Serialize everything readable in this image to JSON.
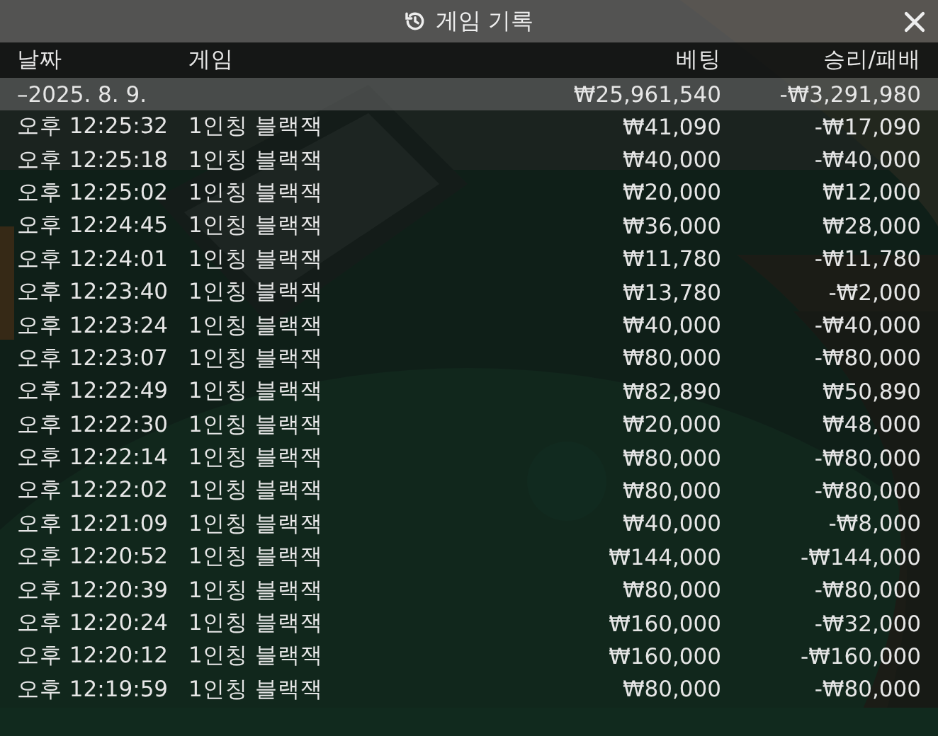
{
  "title": "게임 기록",
  "columns": [
    "날짜",
    "게임",
    "베팅",
    "승리/패배"
  ],
  "date_group": {
    "date": "–2025. 8. 9.",
    "bet": "₩25,961,540",
    "result": "-₩3,291,980"
  },
  "rows": [
    {
      "time": "오후 12:25:32",
      "game": "1인칭 블랙잭",
      "bet": "₩41,090",
      "result": "-₩17,090"
    },
    {
      "time": "오후 12:25:18",
      "game": "1인칭 블랙잭",
      "bet": "₩40,000",
      "result": "-₩40,000"
    },
    {
      "time": "오후 12:25:02",
      "game": "1인칭 블랙잭",
      "bet": "₩20,000",
      "result": "₩12,000"
    },
    {
      "time": "오후 12:24:45",
      "game": "1인칭 블랙잭",
      "bet": "₩36,000",
      "result": "₩28,000"
    },
    {
      "time": "오후 12:24:01",
      "game": "1인칭 블랙잭",
      "bet": "₩11,780",
      "result": "-₩11,780"
    },
    {
      "time": "오후 12:23:40",
      "game": "1인칭 블랙잭",
      "bet": "₩13,780",
      "result": "-₩2,000"
    },
    {
      "time": "오후 12:23:24",
      "game": "1인칭 블랙잭",
      "bet": "₩40,000",
      "result": "-₩40,000"
    },
    {
      "time": "오후 12:23:07",
      "game": "1인칭 블랙잭",
      "bet": "₩80,000",
      "result": "-₩80,000"
    },
    {
      "time": "오후 12:22:49",
      "game": "1인칭 블랙잭",
      "bet": "₩82,890",
      "result": "₩50,890"
    },
    {
      "time": "오후 12:22:30",
      "game": "1인칭 블랙잭",
      "bet": "₩20,000",
      "result": "₩48,000"
    },
    {
      "time": "오후 12:22:14",
      "game": "1인칭 블랙잭",
      "bet": "₩80,000",
      "result": "-₩80,000"
    },
    {
      "time": "오후 12:22:02",
      "game": "1인칭 블랙잭",
      "bet": "₩80,000",
      "result": "-₩80,000"
    },
    {
      "time": "오후 12:21:09",
      "game": "1인칭 블랙잭",
      "bet": "₩40,000",
      "result": "-₩8,000"
    },
    {
      "time": "오후 12:20:52",
      "game": "1인칭 블랙잭",
      "bet": "₩144,000",
      "result": "-₩144,000"
    },
    {
      "time": "오후 12:20:39",
      "game": "1인칭 블랙잭",
      "bet": "₩80,000",
      "result": "-₩80,000"
    },
    {
      "time": "오후 12:20:24",
      "game": "1인칭 블랙잭",
      "bet": "₩160,000",
      "result": "-₩32,000"
    },
    {
      "time": "오후 12:20:12",
      "game": "1인칭 블랙잭",
      "bet": "₩160,000",
      "result": "-₩160,000"
    },
    {
      "time": "오후 12:19:59",
      "game": "1인칭 블랙잭",
      "bet": "₩80,000",
      "result": "-₩80,000"
    }
  ]
}
